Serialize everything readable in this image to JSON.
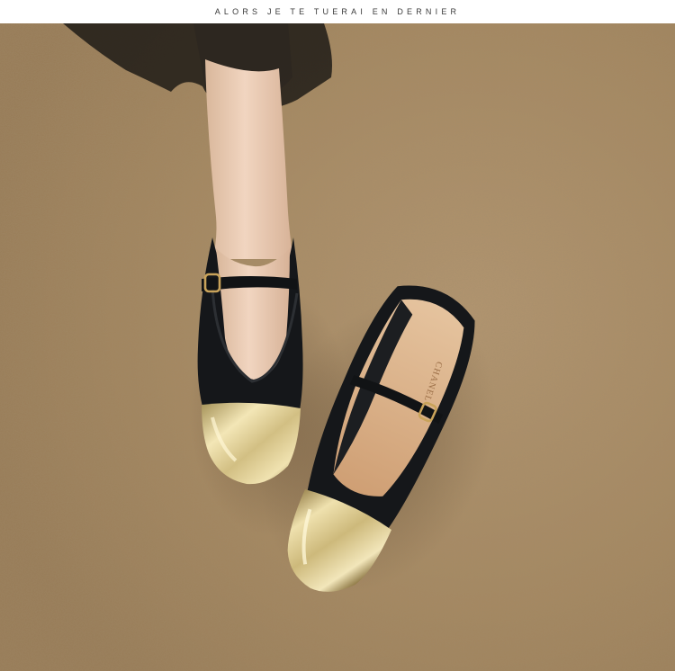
{
  "header": {
    "tagline": "ALORS JE TE TUERAI EN DERNIER"
  },
  "photo": {
    "insole_brand": "CHANEL",
    "colors": {
      "carpet": "#a88a62",
      "shoe_black": "#15171a",
      "gold_toe": "#d8c78c",
      "insole": "#d7ad84",
      "skin": "#e8c8ae",
      "sheer_fabric": "#1a1714"
    }
  }
}
